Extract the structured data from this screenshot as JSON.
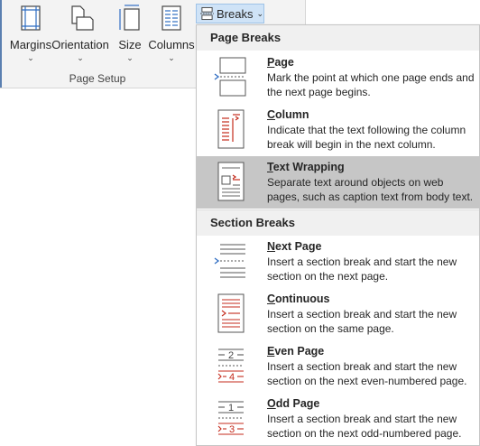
{
  "ribbon": {
    "buttons": [
      {
        "label": "Margins",
        "icon": "margins-icon"
      },
      {
        "label": "Orientation",
        "icon": "orientation-icon"
      },
      {
        "label": "Size",
        "icon": "size-icon"
      },
      {
        "label": "Columns",
        "icon": "columns-icon"
      }
    ],
    "group_label": "Page Setup",
    "breaks_label": "Breaks"
  },
  "menu": {
    "page_breaks_header": "Page Breaks",
    "section_breaks_header": "Section Breaks",
    "page_items": [
      {
        "key": "P",
        "rest": "age",
        "desc": "Mark the point at which one page ends and the next page begins.",
        "icon": "page-break-icon"
      },
      {
        "key": "C",
        "rest": "olumn",
        "desc": "Indicate that the text following the column break will begin in the next column.",
        "icon": "column-break-icon"
      },
      {
        "key": "T",
        "rest": "ext Wrapping",
        "desc": "Separate text around objects on web pages, such as caption text from body text.",
        "icon": "text-wrapping-icon"
      }
    ],
    "section_items": [
      {
        "key": "N",
        "rest": "ext Page",
        "desc": "Insert a section break and start the new section on the next page.",
        "icon": "next-page-icon"
      },
      {
        "key": "C",
        "rest": "ontinuous",
        "desc": "Insert a section break and start the new section on the same page.",
        "icon": "continuous-icon"
      },
      {
        "key": "E",
        "rest": "ven Page",
        "desc": "Insert a section break and start the new section on the next even-numbered page.",
        "icon": "even-page-icon"
      },
      {
        "key": "O",
        "rest": "dd Page",
        "desc": "Insert a section break and start the new section on the next odd-numbered page.",
        "icon": "odd-page-icon"
      }
    ],
    "glyphs": {
      "even_top": "2",
      "even_bottom": "4",
      "odd_top": "1",
      "odd_bottom": "3"
    }
  },
  "colors": {
    "accent_red": "#c42b1c",
    "accent_blue": "#2f6dc2",
    "hover": "#c6c6c6"
  }
}
